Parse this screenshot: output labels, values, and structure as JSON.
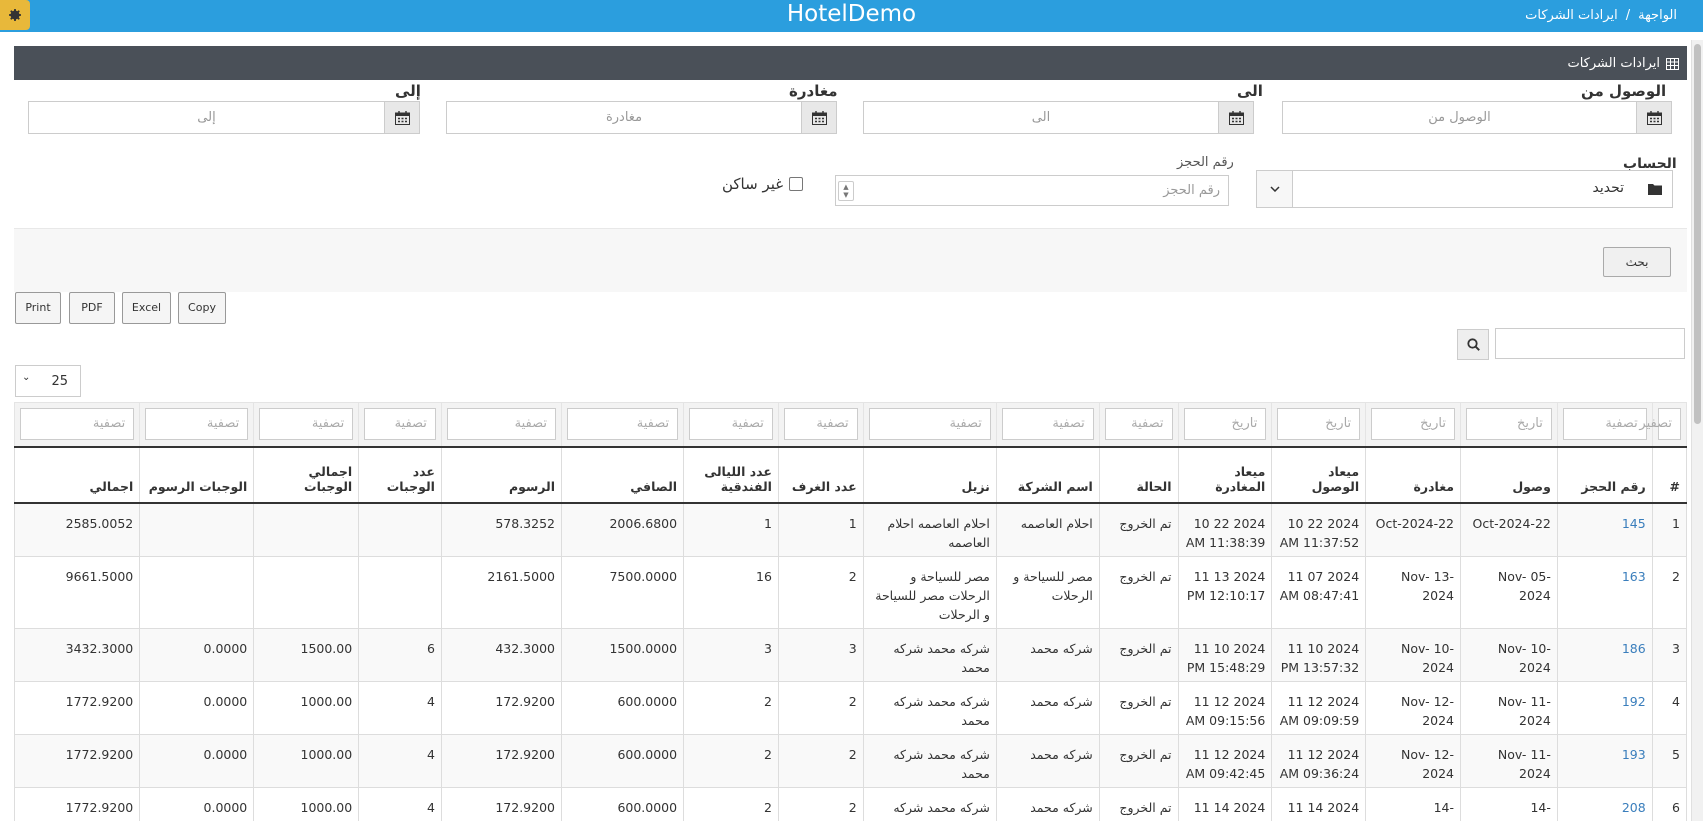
{
  "app": {
    "brand": "HotelDemo",
    "breadcrumb": [
      "الواجهة",
      "/",
      "ايرادات الشركات"
    ]
  },
  "panel": {
    "title": "ايرادات الشركات"
  },
  "filters": {
    "arrival_from": {
      "label": "الوصول من",
      "placeholder": "الوصول من"
    },
    "arrival_to": {
      "label": "الى",
      "placeholder": "الى"
    },
    "departure": {
      "label": "مغادرة",
      "placeholder": "مغادرة"
    },
    "departure_to": {
      "label": "إلى",
      "placeholder": "إلى"
    },
    "account": {
      "label": "الحساب",
      "value": "تحديد"
    },
    "reservation_number": {
      "label": "رقم الحجز",
      "placeholder": "رقم الحجز"
    },
    "not_resident": {
      "label": "غير ساكن",
      "checked": false
    }
  },
  "search_button": "بحث",
  "export_buttons": [
    "Print",
    "PDF",
    "Excel",
    "Copy"
  ],
  "page_size": "25",
  "table": {
    "filter_placeholders": [
      "تصفير",
      "تصفية",
      "تاريخ",
      "تاريخ",
      "تاريخ",
      "تاريخ",
      "تصفية",
      "تصفية",
      "تصفية",
      "تصفية",
      "تصفية",
      "تصفية",
      "تصفية",
      "تصفية",
      "تصفية",
      "تصفية",
      "تصفية"
    ],
    "headers": [
      "#",
      "رقم الحجز",
      "وصول",
      "مغادرة",
      "ميعاد الوصول",
      "ميعاد المغادرة",
      "الحالة",
      "اسم الشركة",
      "نزيل",
      "عدد الغرف",
      "عدد الليالى الفندقية",
      "الصافي",
      "الرسوم",
      "عدد الوجبات",
      "اجمالي الوجبات",
      "الوجبات الرسوم",
      "اجمالي"
    ],
    "rows": [
      [
        "1",
        "145",
        "Oct-2024-22",
        "Oct-2024-22",
        "2024 22 10 AM 11:37:52",
        "2024 22 10 AM 11:38:39",
        "تم الخروج",
        "احلام العاصمه",
        "احلام العاصمه احلام العاصمه",
        "1",
        "1",
        "2006.6800",
        "578.3252",
        "",
        "",
        "",
        "2585.0052"
      ],
      [
        "2",
        "163",
        "-05 Nov-2024",
        "-13 Nov-2024",
        "2024 07 11 AM 08:47:41",
        "2024 13 11 PM 12:10:17",
        "تم الخروج",
        "مصر للسياحة و الرحلات",
        "مصر للسياحة و الرحلات مصر للسياحة و الرحلات",
        "2",
        "16",
        "7500.0000",
        "2161.5000",
        "",
        "",
        "",
        "9661.5000"
      ],
      [
        "3",
        "186",
        "-10 Nov-2024",
        "-10 Nov-2024",
        "2024 10 11 PM 13:57:32",
        "2024 10 11 PM 15:48:29",
        "تم الخروج",
        "شركه محمد",
        "شركه محمد شركه محمد",
        "3",
        "3",
        "1500.0000",
        "432.3000",
        "6",
        "1500.00",
        "0.0000",
        "3432.3000"
      ],
      [
        "4",
        "192",
        "-11 Nov-2024",
        "-12 Nov-2024",
        "2024 12 11 AM 09:09:59",
        "2024 12 11 AM 09:15:56",
        "تم الخروج",
        "شركه محمد",
        "شركه محمد شركه محمد",
        "2",
        "2",
        "600.0000",
        "172.9200",
        "4",
        "1000.00",
        "0.0000",
        "1772.9200"
      ],
      [
        "5",
        "193",
        "-11 Nov-2024",
        "-12 Nov-2024",
        "2024 12 11 AM 09:36:24",
        "2024 12 11 AM 09:42:45",
        "تم الخروج",
        "شركه محمد",
        "شركه محمد شركه محمد",
        "2",
        "2",
        "600.0000",
        "172.9200",
        "4",
        "1000.00",
        "0.0000",
        "1772.9200"
      ],
      [
        "6",
        "208",
        "-14",
        "-14",
        "2024 14 11",
        "2024 14 11",
        "تم الخروج",
        "شركه محمد",
        "شركه محمد شركه",
        "2",
        "2",
        "600.0000",
        "172.9200",
        "4",
        "1000.00",
        "0.0000",
        "1772.9200"
      ]
    ]
  },
  "colors": {
    "topbar": "#2b9ede",
    "gear": "#e8b83a",
    "panel_head": "#4a5058",
    "link": "#3a7ebc"
  }
}
